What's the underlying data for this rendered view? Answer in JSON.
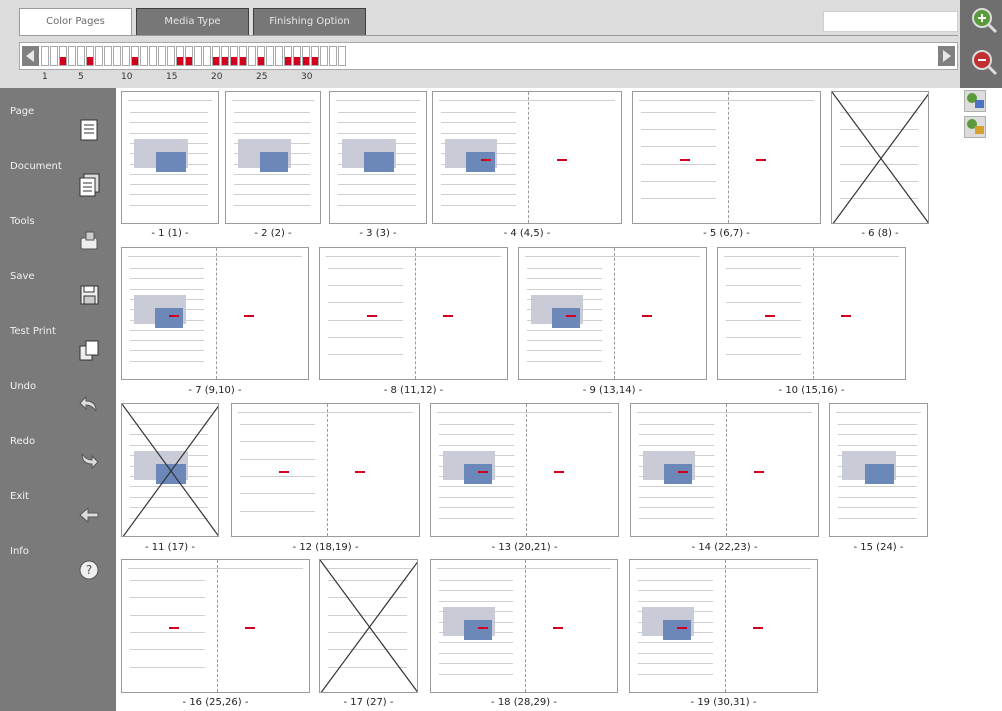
{
  "tabs": [
    {
      "label": "Color Pages",
      "active": true
    },
    {
      "label": "Media Type",
      "active": false
    },
    {
      "label": "Finishing Option",
      "active": false
    }
  ],
  "strip": {
    "page_count": 34,
    "color_pages": [
      3,
      6,
      11,
      16,
      17,
      20,
      21,
      22,
      23,
      25,
      28,
      29,
      30,
      31
    ],
    "numbers": [
      "1",
      "5",
      "10",
      "15",
      "20",
      "25",
      "30"
    ]
  },
  "sidebar": {
    "items": [
      {
        "label": "Page",
        "icon": "page-icon"
      },
      {
        "label": "Document",
        "icon": "document-icon"
      },
      {
        "label": "Tools",
        "icon": "tools-icon"
      },
      {
        "label": "Save",
        "icon": "save-icon"
      },
      {
        "label": "Test Print",
        "icon": "test-print-icon"
      },
      {
        "label": "Undo",
        "icon": "undo-icon"
      },
      {
        "label": "Redo",
        "icon": "redo-icon"
      },
      {
        "label": "Exit",
        "icon": "exit-icon"
      },
      {
        "label": "Info",
        "icon": "info-icon"
      }
    ]
  },
  "zoom": {
    "in_icon": "zoom-in-icon",
    "out_icon": "zoom-out-icon"
  },
  "thumbnails": [
    {
      "label": "- 1 (1) -",
      "type": "single",
      "crossed": false,
      "color": true
    },
    {
      "label": "- 2 (2) -",
      "type": "single",
      "crossed": false,
      "color": true
    },
    {
      "label": "- 3 (3) -",
      "type": "single",
      "crossed": false,
      "color": true
    },
    {
      "label": "- 4 (4,5) -",
      "type": "double",
      "crossed": false,
      "color": true
    },
    {
      "label": "- 5 (6,7) -",
      "type": "double",
      "crossed": false,
      "color": false
    },
    {
      "label": "- 6 (8) -",
      "type": "single",
      "crossed": true,
      "color": false
    },
    {
      "label": "- 7 (9,10) -",
      "type": "double",
      "crossed": false,
      "color": true
    },
    {
      "label": "- 8 (11,12) -",
      "type": "double",
      "crossed": false,
      "color": false
    },
    {
      "label": "- 9 (13,14) -",
      "type": "double",
      "crossed": false,
      "color": true
    },
    {
      "label": "- 10 (15,16) -",
      "type": "double",
      "crossed": false,
      "color": false
    },
    {
      "label": "- 11 (17) -",
      "type": "single",
      "crossed": true,
      "color": true
    },
    {
      "label": "- 12 (18,19) -",
      "type": "double",
      "crossed": false,
      "color": false
    },
    {
      "label": "- 13 (20,21) -",
      "type": "double",
      "crossed": false,
      "color": true
    },
    {
      "label": "- 14 (22,23) -",
      "type": "double",
      "crossed": false,
      "color": true
    },
    {
      "label": "- 15 (24) -",
      "type": "single",
      "crossed": false,
      "color": true
    },
    {
      "label": "- 16 (25,26) -",
      "type": "double",
      "crossed": false,
      "color": false
    },
    {
      "label": "- 17 (27) -",
      "type": "single",
      "crossed": true,
      "color": false
    },
    {
      "label": "- 18 (28,29) -",
      "type": "double",
      "crossed": false,
      "color": true
    },
    {
      "label": "- 19 (30,31) -",
      "type": "double",
      "crossed": false,
      "color": true
    }
  ],
  "colors": {
    "accent_red": "#d2001e",
    "sidebar_bg": "#7a7a7a",
    "topbar_bg": "#dcdcdc"
  }
}
